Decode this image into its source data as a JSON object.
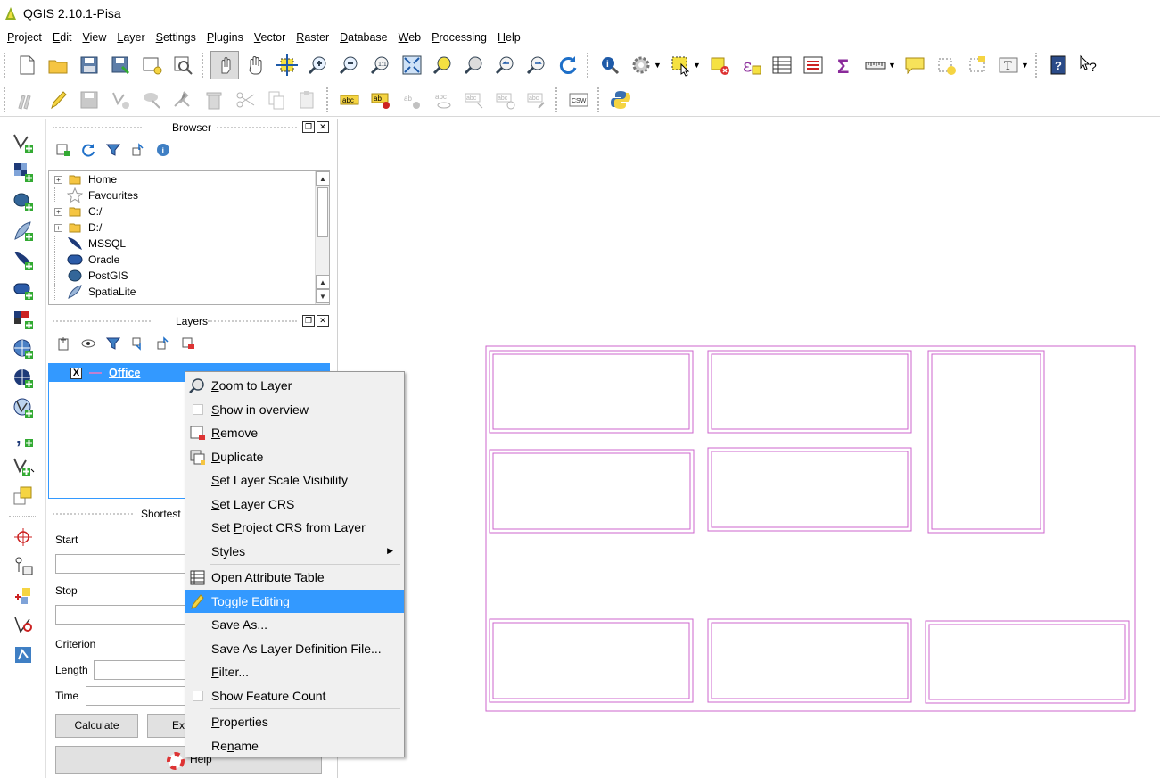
{
  "window": {
    "title": "QGIS 2.10.1-Pisa"
  },
  "menubar": [
    "Project",
    "Edit",
    "View",
    "Layer",
    "Settings",
    "Plugins",
    "Vector",
    "Raster",
    "Database",
    "Web",
    "Processing",
    "Help"
  ],
  "browser": {
    "title": "Browser",
    "items": [
      {
        "label": "Home",
        "icon": "folder-icon",
        "expandable": true
      },
      {
        "label": "Favourites",
        "icon": "star-icon",
        "expandable": false
      },
      {
        "label": "C:/",
        "icon": "folder-icon",
        "expandable": true
      },
      {
        "label": "D:/",
        "icon": "folder-icon",
        "expandable": true
      },
      {
        "label": "MSSQL",
        "icon": "mssql-icon",
        "expandable": false
      },
      {
        "label": "Oracle",
        "icon": "oracle-icon",
        "expandable": false
      },
      {
        "label": "PostGIS",
        "icon": "postgis-icon",
        "expandable": false
      },
      {
        "label": "SpatiaLite",
        "icon": "spatialite-icon",
        "expandable": false
      }
    ]
  },
  "layers": {
    "title": "Layers",
    "items": [
      {
        "name": "Office",
        "checked": true,
        "checkmark": "X"
      }
    ]
  },
  "shortest_path": {
    "title": "Shortest",
    "start_label": "Start",
    "stop_label": "Stop",
    "criterion_label": "Criterion",
    "length_label": "Length",
    "time_label": "Time",
    "calculate_label": "Calculate",
    "export_label": "Ex",
    "help_label": "Help"
  },
  "context_menu": {
    "items": [
      {
        "label": "Zoom to Layer",
        "underline": "Z",
        "rest": "oom to Layer",
        "icon": "zoom-layer-icon"
      },
      {
        "label": "Show in overview",
        "underline": "S",
        "rest": "how in overview",
        "icon": "checkbox-icon"
      },
      {
        "label": "Remove",
        "underline": "R",
        "rest": "emove",
        "icon": "remove-icon"
      },
      {
        "label": "Duplicate",
        "underline": "D",
        "rest": "uplicate",
        "icon": "duplicate-icon"
      },
      {
        "label": "Set Layer Scale Visibility",
        "underline": "S",
        "rest": "et Layer Scale Visibility",
        "icon": ""
      },
      {
        "label": "Set Layer CRS",
        "underline": "S",
        "rest": "et Layer CRS",
        "icon": ""
      },
      {
        "label": "Set Project CRS from Layer",
        "pre": "Set ",
        "underline": "P",
        "rest": "roject CRS from Layer",
        "icon": ""
      },
      {
        "label": "Styles",
        "icon": "",
        "submenu": true
      },
      {
        "label": "Open Attribute Table",
        "underline": "O",
        "rest": "pen Attribute Table",
        "icon": "table-icon",
        "sep_before": true
      },
      {
        "label": "Toggle Editing",
        "icon": "pencil-icon",
        "highlight": true
      },
      {
        "label": "Save As...",
        "icon": ""
      },
      {
        "label": "Save As Layer Definition File...",
        "icon": ""
      },
      {
        "label": "Filter...",
        "underline": "F",
        "rest": "ilter...",
        "icon": ""
      },
      {
        "label": "Show Feature Count",
        "icon": "checkbox-icon"
      },
      {
        "label": "Properties",
        "underline": "P",
        "rest": "roperties",
        "icon": "",
        "sep_before": true
      },
      {
        "label": "Rename",
        "pre": "Re",
        "underline": "n",
        "rest": "ame",
        "icon": ""
      }
    ]
  },
  "map": {
    "feature_color": "#cc66cc"
  }
}
